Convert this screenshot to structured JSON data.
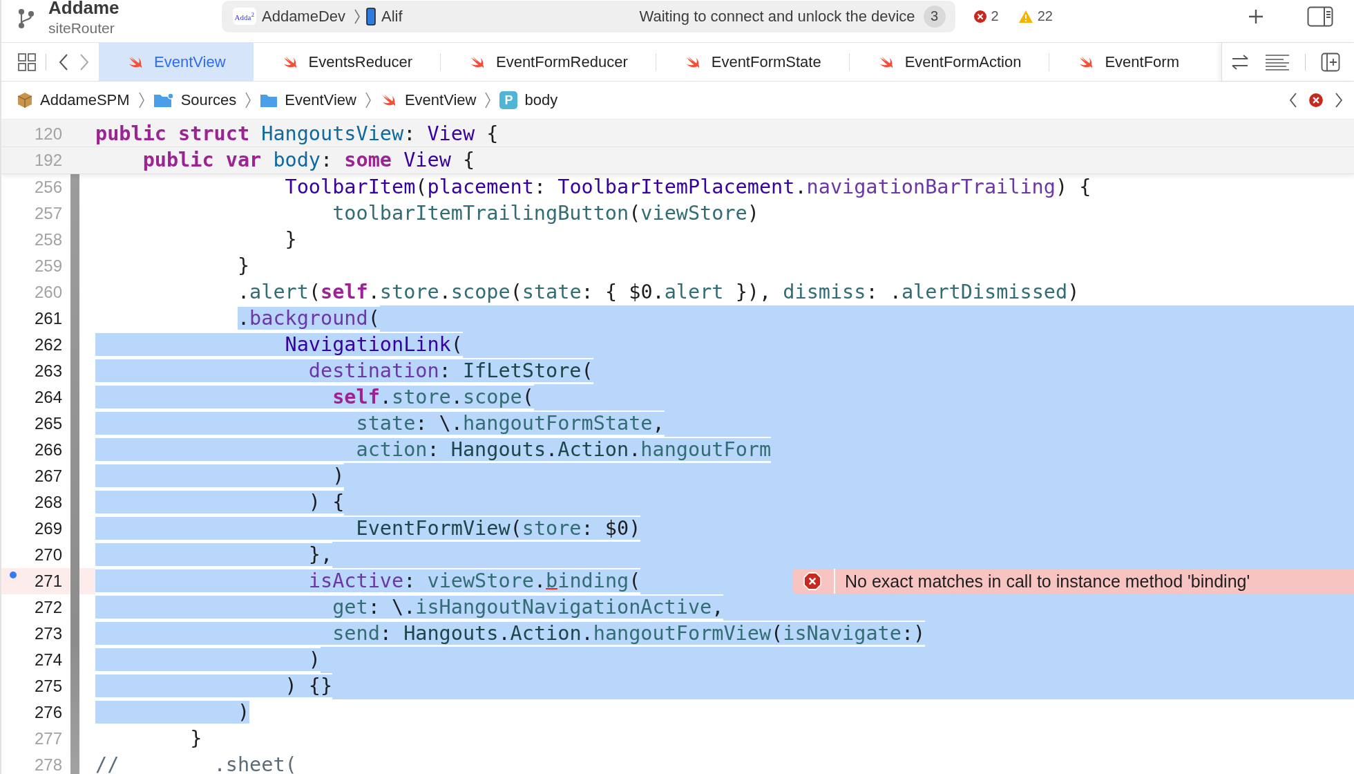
{
  "toolbar": {
    "project": "Addame",
    "branch": "siteRouter",
    "activity": {
      "app_logo": "Adda$^{2}$",
      "scheme": "AddameDev",
      "device": "Alif",
      "status": "Waiting to connect and unlock the device",
      "count": "3"
    },
    "errors": "2",
    "warnings": "22"
  },
  "tabs": [
    {
      "label": "EventView",
      "selected": true
    },
    {
      "label": "EventsReducer",
      "selected": false
    },
    {
      "label": "EventFormReducer",
      "selected": false
    },
    {
      "label": "EventFormState",
      "selected": false
    },
    {
      "label": "EventFormAction",
      "selected": false
    },
    {
      "label": "EventForm",
      "selected": false
    }
  ],
  "breadcrumbs": [
    {
      "label": "AddameSPM",
      "kind": "package"
    },
    {
      "label": "Sources",
      "kind": "sources"
    },
    {
      "label": "EventView",
      "kind": "folder"
    },
    {
      "label": "EventView",
      "kind": "swift"
    },
    {
      "label": "body",
      "kind": "property",
      "badge": "P"
    }
  ],
  "editor": {
    "sticky_lines": [
      {
        "number": "120",
        "tokens": [
          {
            "text": "public",
            "kind": "keyword"
          },
          {
            "text": " struct",
            "kind": "keyword"
          },
          {
            "text": " HangoutsView",
            "kind": "decl"
          },
          {
            "text": ":",
            "kind": "plain"
          },
          {
            "text": " View",
            "kind": "systype"
          },
          {
            "text": " {",
            "kind": "plain"
          }
        ]
      },
      {
        "number": "192",
        "tokens": [
          {
            "text": "    public",
            "kind": "keyword"
          },
          {
            "text": " var",
            "kind": "keyword"
          },
          {
            "text": " body",
            "kind": "decl"
          },
          {
            "text": ":",
            "kind": "plain"
          },
          {
            "text": " some",
            "kind": "keyword"
          },
          {
            "text": " View",
            "kind": "systype"
          },
          {
            "text": " {",
            "kind": "plain"
          }
        ]
      }
    ],
    "lines": [
      {
        "number": "256",
        "selected": false,
        "tokens": [
          {
            "text": "                ToolbarItem",
            "kind": "systype"
          },
          {
            "text": "(",
            "kind": "plain"
          },
          {
            "text": "placement",
            "kind": "systype"
          },
          {
            "text": ": ",
            "kind": "plain"
          },
          {
            "text": "ToolbarItemPlacement",
            "kind": "systype"
          },
          {
            "text": ".",
            "kind": "plain"
          },
          {
            "text": "navigationBarTrailing",
            "kind": "sysmember"
          },
          {
            "text": ") {",
            "kind": "plain"
          }
        ]
      },
      {
        "number": "257",
        "selected": false,
        "tokens": [
          {
            "text": "                    toolbarItemTrailingButton",
            "kind": "member"
          },
          {
            "text": "(",
            "kind": "plain"
          },
          {
            "text": "viewStore",
            "kind": "member"
          },
          {
            "text": ")",
            "kind": "plain"
          }
        ]
      },
      {
        "number": "258",
        "selected": false,
        "tokens": [
          {
            "text": "                }",
            "kind": "plain"
          }
        ]
      },
      {
        "number": "259",
        "selected": false,
        "tokens": [
          {
            "text": "            }",
            "kind": "plain"
          }
        ]
      },
      {
        "number": "260",
        "selected": false,
        "tokens": [
          {
            "text": "            .",
            "kind": "plain"
          },
          {
            "text": "alert",
            "kind": "member"
          },
          {
            "text": "(",
            "kind": "plain"
          },
          {
            "text": "self",
            "kind": "keyword"
          },
          {
            "text": ".",
            "kind": "plain"
          },
          {
            "text": "store",
            "kind": "member"
          },
          {
            "text": ".",
            "kind": "plain"
          },
          {
            "text": "scope",
            "kind": "member"
          },
          {
            "text": "(",
            "kind": "plain"
          },
          {
            "text": "state",
            "kind": "member"
          },
          {
            "text": ": { $0.",
            "kind": "plain"
          },
          {
            "text": "alert",
            "kind": "member"
          },
          {
            "text": " }), ",
            "kind": "plain"
          },
          {
            "text": "dismiss",
            "kind": "member"
          },
          {
            "text": ": .",
            "kind": "plain"
          },
          {
            "text": "alertDismissed",
            "kind": "member"
          },
          {
            "text": ")",
            "kind": "plain"
          }
        ]
      },
      {
        "number": "261",
        "selected": true,
        "selection_start": true,
        "tokens": [
          {
            "text": "            .",
            "kind": "plain"
          },
          {
            "text": "background",
            "kind": "sysmember"
          },
          {
            "text": "(",
            "kind": "plain"
          }
        ]
      },
      {
        "number": "262",
        "selected": true,
        "tokens": [
          {
            "text": "                NavigationLink",
            "kind": "systype"
          },
          {
            "text": "(",
            "kind": "plain"
          }
        ]
      },
      {
        "number": "263",
        "selected": true,
        "tokens": [
          {
            "text": "                  destination",
            "kind": "sysmember"
          },
          {
            "text": ": ",
            "kind": "plain"
          },
          {
            "text": "IfLetStore",
            "kind": "type"
          },
          {
            "text": "(",
            "kind": "plain"
          }
        ]
      },
      {
        "number": "264",
        "selected": true,
        "tokens": [
          {
            "text": "                    self",
            "kind": "keyword"
          },
          {
            "text": ".",
            "kind": "plain"
          },
          {
            "text": "store",
            "kind": "member"
          },
          {
            "text": ".",
            "kind": "plain"
          },
          {
            "text": "scope",
            "kind": "member"
          },
          {
            "text": "(",
            "kind": "plain"
          }
        ]
      },
      {
        "number": "265",
        "selected": true,
        "tokens": [
          {
            "text": "                      state",
            "kind": "member"
          },
          {
            "text": ": \\.",
            "kind": "plain"
          },
          {
            "text": "hangoutFormState",
            "kind": "member"
          },
          {
            "text": ",",
            "kind": "plain"
          }
        ]
      },
      {
        "number": "266",
        "selected": true,
        "tokens": [
          {
            "text": "                      action",
            "kind": "member"
          },
          {
            "text": ": ",
            "kind": "plain"
          },
          {
            "text": "Hangouts",
            "kind": "type"
          },
          {
            "text": ".",
            "kind": "plain"
          },
          {
            "text": "Action",
            "kind": "type"
          },
          {
            "text": ".",
            "kind": "plain"
          },
          {
            "text": "hangoutForm",
            "kind": "member"
          }
        ]
      },
      {
        "number": "267",
        "selected": true,
        "tokens": [
          {
            "text": "                    )",
            "kind": "plain"
          }
        ]
      },
      {
        "number": "268",
        "selected": true,
        "tokens": [
          {
            "text": "                  ) {",
            "kind": "plain"
          }
        ]
      },
      {
        "number": "269",
        "selected": true,
        "tokens": [
          {
            "text": "                      EventFormView",
            "kind": "type"
          },
          {
            "text": "(",
            "kind": "plain"
          },
          {
            "text": "store",
            "kind": "member"
          },
          {
            "text": ": $0)",
            "kind": "plain"
          }
        ]
      },
      {
        "number": "270",
        "selected": true,
        "tokens": [
          {
            "text": "                  },",
            "kind": "plain"
          }
        ]
      },
      {
        "number": "271",
        "selected": true,
        "marked": true,
        "error": {
          "message": "No exact matches in call to instance method 'binding'"
        },
        "tokens": [
          {
            "text": "                  isActive",
            "kind": "sysmember"
          },
          {
            "text": ": ",
            "kind": "plain"
          },
          {
            "text": "viewStore",
            "kind": "member"
          },
          {
            "text": ".",
            "kind": "plain"
          },
          {
            "text": "b",
            "kind": "member",
            "underline": true
          },
          {
            "text": "inding",
            "kind": "member"
          },
          {
            "text": "(",
            "kind": "plain"
          }
        ]
      },
      {
        "number": "272",
        "selected": true,
        "tokens": [
          {
            "text": "                    get",
            "kind": "member"
          },
          {
            "text": ": \\.",
            "kind": "plain"
          },
          {
            "text": "isHangoutNavigationActive",
            "kind": "member"
          },
          {
            "text": ",",
            "kind": "plain"
          }
        ]
      },
      {
        "number": "273",
        "selected": true,
        "tokens": [
          {
            "text": "                    send",
            "kind": "member"
          },
          {
            "text": ": ",
            "kind": "plain"
          },
          {
            "text": "Hangouts",
            "kind": "type"
          },
          {
            "text": ".",
            "kind": "plain"
          },
          {
            "text": "Action",
            "kind": "type"
          },
          {
            "text": ".",
            "kind": "plain"
          },
          {
            "text": "hangoutFormView",
            "kind": "member"
          },
          {
            "text": "(",
            "kind": "plain"
          },
          {
            "text": "isNavigate",
            "kind": "member"
          },
          {
            "text": ":)",
            "kind": "plain"
          }
        ]
      },
      {
        "number": "274",
        "selected": true,
        "tokens": [
          {
            "text": "                  )",
            "kind": "plain"
          }
        ]
      },
      {
        "number": "275",
        "selected": true,
        "tokens": [
          {
            "text": "                ) {}",
            "kind": "plain"
          }
        ]
      },
      {
        "number": "276",
        "selected": true,
        "selection_end": true,
        "tokens": [
          {
            "text": "            )",
            "kind": "plain"
          }
        ]
      },
      {
        "number": "277",
        "selected": false,
        "tokens": [
          {
            "text": "        }",
            "kind": "plain"
          }
        ]
      },
      {
        "number": "278",
        "selected": false,
        "tokens": [
          {
            "text": "//        .sheet(",
            "kind": "comment"
          }
        ]
      }
    ]
  }
}
